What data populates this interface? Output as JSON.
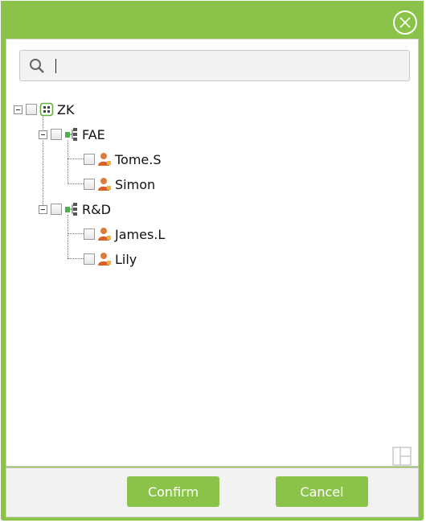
{
  "dialog": {
    "close_icon": "close-circle-icon",
    "accent_color": "#8bc34a"
  },
  "search": {
    "value": "",
    "icon": "search-icon"
  },
  "tree": {
    "root": {
      "label": "ZK",
      "icon": "company-icon"
    },
    "departments": [
      {
        "label": "FAE",
        "icon": "department-icon",
        "members": [
          "Tome.S",
          "Simon"
        ]
      },
      {
        "label": "R&D",
        "icon": "department-icon",
        "members": [
          "James.L",
          "Lily"
        ]
      }
    ],
    "member_icon": "person-icon"
  },
  "footer": {
    "confirm_label": "Confirm",
    "cancel_label": "Cancel"
  },
  "side_icon": "panel-layout-icon"
}
